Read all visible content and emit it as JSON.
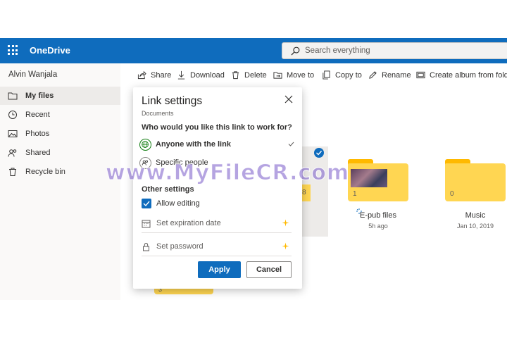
{
  "app": {
    "brand": "OneDrive"
  },
  "search": {
    "placeholder": "Search everything"
  },
  "user": {
    "name": "Alvin Wanjala"
  },
  "sidebar": {
    "items": [
      {
        "label": "My files",
        "icon": "folder-icon",
        "active": true
      },
      {
        "label": "Recent",
        "icon": "clock-icon"
      },
      {
        "label": "Photos",
        "icon": "photo-icon"
      },
      {
        "label": "Shared",
        "icon": "people-icon"
      },
      {
        "label": "Recycle bin",
        "icon": "trash-icon"
      }
    ]
  },
  "toolbar": {
    "share": "Share",
    "download": "Download",
    "delete": "Delete",
    "move_to": "Move to",
    "copy_to": "Copy to",
    "rename": "Rename",
    "create_album": "Create album from folder"
  },
  "files": [
    {
      "name": "",
      "count": "8",
      "date": ""
    },
    {
      "name": "E-pub files",
      "count": "1",
      "date": "5h ago"
    },
    {
      "name": "Music",
      "count": "0",
      "date": "Jan 10, 2019"
    },
    {
      "name": "",
      "count": "3",
      "date": ""
    }
  ],
  "dialog": {
    "title": "Link settings",
    "subtitle": "Documents",
    "question": "Who would you like this link to work for?",
    "options": [
      {
        "label": "Anyone with the link",
        "selected": true,
        "icon": "globe-icon"
      },
      {
        "label": "Specific people",
        "selected": false,
        "icon": "people-icon"
      }
    ],
    "other_settings": "Other settings",
    "allow_editing": "Allow editing",
    "expiration": "Set expiration date",
    "password": "Set password",
    "apply": "Apply",
    "cancel": "Cancel"
  },
  "watermark": "www.MyFileCR.com",
  "colors": {
    "brand_blue": "#0f6cbd",
    "folder_yellow": "#ffd652",
    "folder_tab": "#ffb900",
    "premium_star": "#ffb900",
    "selected_bg": "#edebe9"
  }
}
